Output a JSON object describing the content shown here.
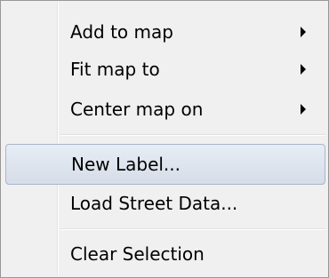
{
  "menu": {
    "items": [
      {
        "label": "Add to map",
        "has_submenu": true
      },
      {
        "label": "Fit map to",
        "has_submenu": true
      },
      {
        "label": "Center map on",
        "has_submenu": true
      },
      {
        "label": "New Label...",
        "has_submenu": false,
        "highlighted": true
      },
      {
        "label": "Load Street Data...",
        "has_submenu": false
      },
      {
        "label": "Clear Selection",
        "has_submenu": false
      }
    ],
    "icons": {
      "submenu_arrow": "triangle-right-icon"
    },
    "colors": {
      "background": "#f0f0f0",
      "border": "#979797",
      "highlight_border": "#aab6c8",
      "highlight_fill": "#dfe5ee"
    }
  }
}
